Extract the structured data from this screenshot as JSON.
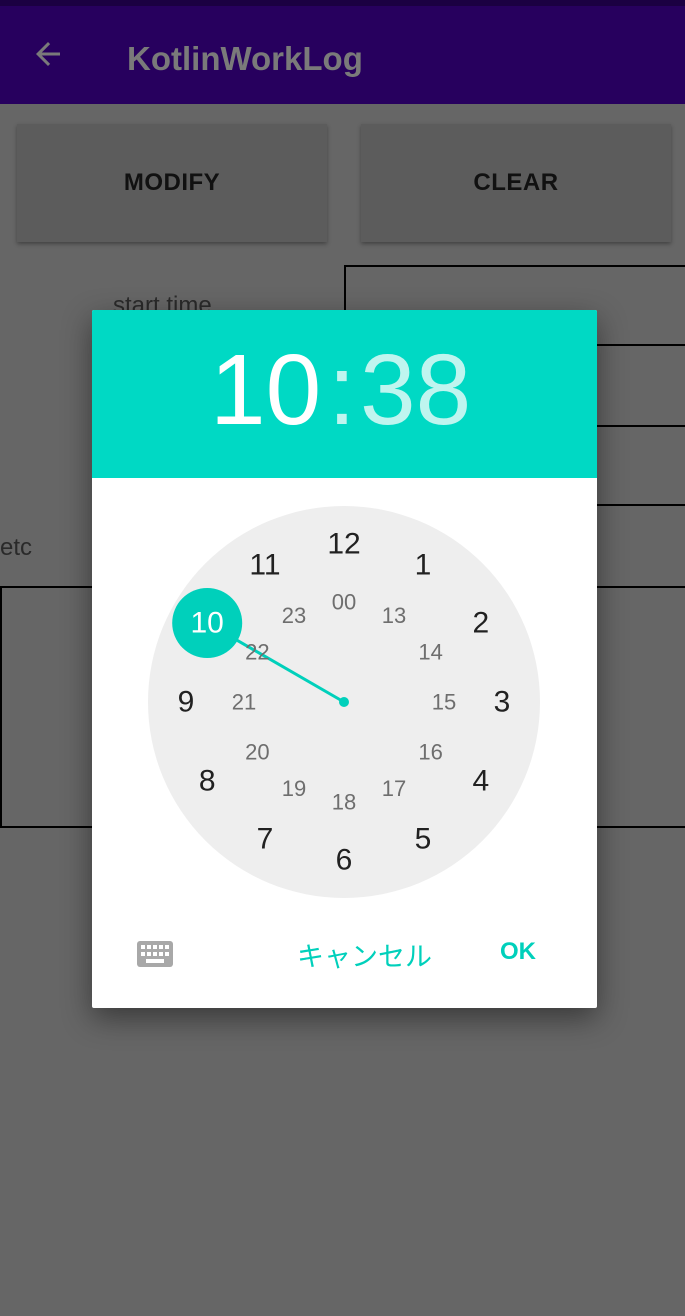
{
  "app": {
    "title": "KotlinWorkLog"
  },
  "buttons": {
    "modify": "MODIFY",
    "clear": "CLEAR"
  },
  "form": {
    "start_time_label": "start time",
    "etc_label": "etc"
  },
  "picker": {
    "hour": "10",
    "separator": ":",
    "minute": "38",
    "outer_numbers": [
      "12",
      "1",
      "2",
      "3",
      "4",
      "5",
      "6",
      "7",
      "8",
      "9",
      "10",
      "11"
    ],
    "inner_numbers": [
      "00",
      "13",
      "14",
      "15",
      "16",
      "17",
      "18",
      "19",
      "20",
      "21",
      "22",
      "23"
    ],
    "selected_hour": "10",
    "cancel_label": "キャンセル",
    "ok_label": "OK"
  },
  "colors": {
    "accent": "#00d9c4",
    "appbar": "#27005e",
    "scrim_background": "#666666",
    "clock_face": "#eeeeee"
  },
  "icons": {
    "back": "back-arrow-icon",
    "keyboard": "keyboard-icon"
  }
}
